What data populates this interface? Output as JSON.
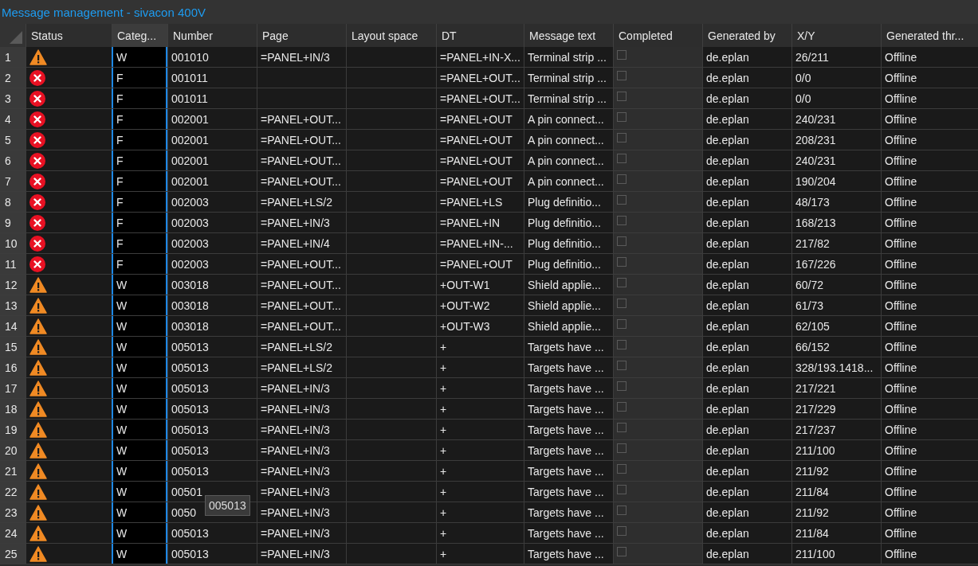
{
  "window": {
    "title": "Message management - sivacon 400V"
  },
  "columns": [
    {
      "label": "Status",
      "selected": false
    },
    {
      "label": "Categ...",
      "selected": true
    },
    {
      "label": "Number",
      "selected": false
    },
    {
      "label": "Page",
      "selected": false
    },
    {
      "label": "Layout space",
      "selected": false
    },
    {
      "label": "DT",
      "selected": false
    },
    {
      "label": "Message text",
      "selected": false
    },
    {
      "label": "Completed",
      "selected": false
    },
    {
      "label": "Generated by",
      "selected": false
    },
    {
      "label": "X/Y",
      "selected": false
    },
    {
      "label": "Generated thr...",
      "selected": false
    }
  ],
  "rows": [
    {
      "index": "1",
      "kind": "warning",
      "category": "W",
      "number": "001010",
      "page": "=PANEL+IN/3",
      "dt": "=PANEL+IN-X...",
      "message": "Terminal strip ...",
      "completed": false,
      "generated_by": "de.eplan",
      "xy": "26/211",
      "generated_through": "Offline"
    },
    {
      "index": "2",
      "kind": "error",
      "category": "F",
      "number": "001011",
      "dt": "=PANEL+OUT...",
      "message": "Terminal strip ...",
      "completed": false,
      "generated_by": "de.eplan",
      "xy": "0/0",
      "generated_through": "Offline"
    },
    {
      "index": "3",
      "kind": "error",
      "category": "F",
      "number": "001011",
      "dt": "=PANEL+OUT...",
      "message": "Terminal strip ...",
      "completed": false,
      "generated_by": "de.eplan",
      "xy": "0/0",
      "generated_through": "Offline"
    },
    {
      "index": "4",
      "kind": "error",
      "category": "F",
      "number": "002001",
      "page": "=PANEL+OUT...",
      "dt": "=PANEL+OUT",
      "message": "A pin connect...",
      "completed": false,
      "generated_by": "de.eplan",
      "xy": "240/231",
      "generated_through": "Offline"
    },
    {
      "index": "5",
      "kind": "error",
      "category": "F",
      "number": "002001",
      "page": "=PANEL+OUT...",
      "dt": "=PANEL+OUT",
      "message": "A pin connect...",
      "completed": false,
      "generated_by": "de.eplan",
      "xy": "208/231",
      "generated_through": "Offline"
    },
    {
      "index": "6",
      "kind": "error",
      "category": "F",
      "number": "002001",
      "page": "=PANEL+OUT...",
      "dt": "=PANEL+OUT",
      "message": "A pin connect...",
      "completed": false,
      "generated_by": "de.eplan",
      "xy": "240/231",
      "generated_through": "Offline"
    },
    {
      "index": "7",
      "kind": "error",
      "category": "F",
      "number": "002001",
      "page": "=PANEL+OUT...",
      "dt": "=PANEL+OUT",
      "message": "A pin connect...",
      "completed": false,
      "generated_by": "de.eplan",
      "xy": "190/204",
      "generated_through": "Offline"
    },
    {
      "index": "8",
      "kind": "error",
      "category": "F",
      "number": "002003",
      "page": "=PANEL+LS/2",
      "dt": "=PANEL+LS",
      "message": "Plug definitio...",
      "completed": false,
      "generated_by": "de.eplan",
      "xy": "48/173",
      "generated_through": "Offline"
    },
    {
      "index": "9",
      "kind": "error",
      "category": "F",
      "number": "002003",
      "page": "=PANEL+IN/3",
      "dt": "=PANEL+IN",
      "message": "Plug definitio...",
      "completed": false,
      "generated_by": "de.eplan",
      "xy": "168/213",
      "generated_through": "Offline"
    },
    {
      "index": "10",
      "kind": "error",
      "category": "F",
      "number": "002003",
      "page": "=PANEL+IN/4",
      "dt": "=PANEL+IN-...",
      "message": "Plug definitio...",
      "completed": false,
      "generated_by": "de.eplan",
      "xy": "217/82",
      "generated_through": "Offline"
    },
    {
      "index": "11",
      "kind": "error",
      "category": "F",
      "number": "002003",
      "page": "=PANEL+OUT...",
      "dt": "=PANEL+OUT",
      "message": "Plug definitio...",
      "completed": false,
      "generated_by": "de.eplan",
      "xy": "167/226",
      "generated_through": "Offline"
    },
    {
      "index": "12",
      "kind": "warning",
      "category": "W",
      "number": "003018",
      "page": "=PANEL+OUT...",
      "dt": "+OUT-W1",
      "message": "Shield applie...",
      "completed": false,
      "generated_by": "de.eplan",
      "xy": "60/72",
      "generated_through": "Offline"
    },
    {
      "index": "13",
      "kind": "warning",
      "category": "W",
      "number": "003018",
      "page": "=PANEL+OUT...",
      "dt": "+OUT-W2",
      "message": "Shield applie...",
      "completed": false,
      "generated_by": "de.eplan",
      "xy": "61/73",
      "generated_through": "Offline"
    },
    {
      "index": "14",
      "kind": "warning",
      "category": "W",
      "number": "003018",
      "page": "=PANEL+OUT...",
      "dt": "+OUT-W3",
      "message": "Shield applie...",
      "completed": false,
      "generated_by": "de.eplan",
      "xy": "62/105",
      "generated_through": "Offline"
    },
    {
      "index": "15",
      "kind": "warning",
      "category": "W",
      "number": "005013",
      "page": "=PANEL+LS/2",
      "dt": "+",
      "message": "Targets have ...",
      "completed": false,
      "generated_by": "de.eplan",
      "xy": "66/152",
      "generated_through": "Offline"
    },
    {
      "index": "16",
      "kind": "warning",
      "category": "W",
      "number": "005013",
      "page": "=PANEL+LS/2",
      "dt": "+",
      "message": "Targets have ...",
      "completed": false,
      "generated_by": "de.eplan",
      "xy": "328/193.1418...",
      "generated_through": "Offline"
    },
    {
      "index": "17",
      "kind": "warning",
      "category": "W",
      "number": "005013",
      "page": "=PANEL+IN/3",
      "dt": "+",
      "message": "Targets have ...",
      "completed": false,
      "generated_by": "de.eplan",
      "xy": "217/221",
      "generated_through": "Offline"
    },
    {
      "index": "18",
      "kind": "warning",
      "category": "W",
      "number": "005013",
      "page": "=PANEL+IN/3",
      "dt": "+",
      "message": "Targets have ...",
      "completed": false,
      "generated_by": "de.eplan",
      "xy": "217/229",
      "generated_through": "Offline"
    },
    {
      "index": "19",
      "kind": "warning",
      "category": "W",
      "number": "005013",
      "page": "=PANEL+IN/3",
      "dt": "+",
      "message": "Targets have ...",
      "completed": false,
      "generated_by": "de.eplan",
      "xy": "217/237",
      "generated_through": "Offline"
    },
    {
      "index": "20",
      "kind": "warning",
      "category": "W",
      "number": "005013",
      "page": "=PANEL+IN/3",
      "dt": "+",
      "message": "Targets have ...",
      "completed": false,
      "generated_by": "de.eplan",
      "xy": "211/100",
      "generated_through": "Offline"
    },
    {
      "index": "21",
      "kind": "warning",
      "category": "W",
      "number": "005013",
      "page": "=PANEL+IN/3",
      "dt": "+",
      "message": "Targets have ...",
      "completed": false,
      "generated_by": "de.eplan",
      "xy": "211/92",
      "generated_through": "Offline"
    },
    {
      "index": "22",
      "kind": "warning",
      "category": "W",
      "number": "00501",
      "page": "=PANEL+IN/3",
      "dt": "+",
      "message": "Targets have ...",
      "completed": false,
      "generated_by": "de.eplan",
      "xy": "211/84",
      "generated_through": "Offline"
    },
    {
      "index": "23",
      "kind": "warning",
      "category": "W",
      "number": "0050",
      "page": "=PANEL+IN/3",
      "dt": "+",
      "message": "Targets have ...",
      "completed": false,
      "generated_by": "de.eplan",
      "xy": "211/92",
      "generated_through": "Offline"
    },
    {
      "index": "24",
      "kind": "warning",
      "category": "W",
      "number": "005013",
      "page": "=PANEL+IN/3",
      "dt": "+",
      "message": "Targets have ...",
      "completed": false,
      "generated_by": "de.eplan",
      "xy": "211/84",
      "generated_through": "Offline"
    },
    {
      "index": "25",
      "kind": "warning",
      "category": "W",
      "number": "005013",
      "page": "=PANEL+IN/3",
      "dt": "+",
      "message": "Targets have ...",
      "completed": false,
      "generated_by": "de.eplan",
      "xy": "211/100",
      "generated_through": "Offline"
    }
  ],
  "tooltip": "005013"
}
